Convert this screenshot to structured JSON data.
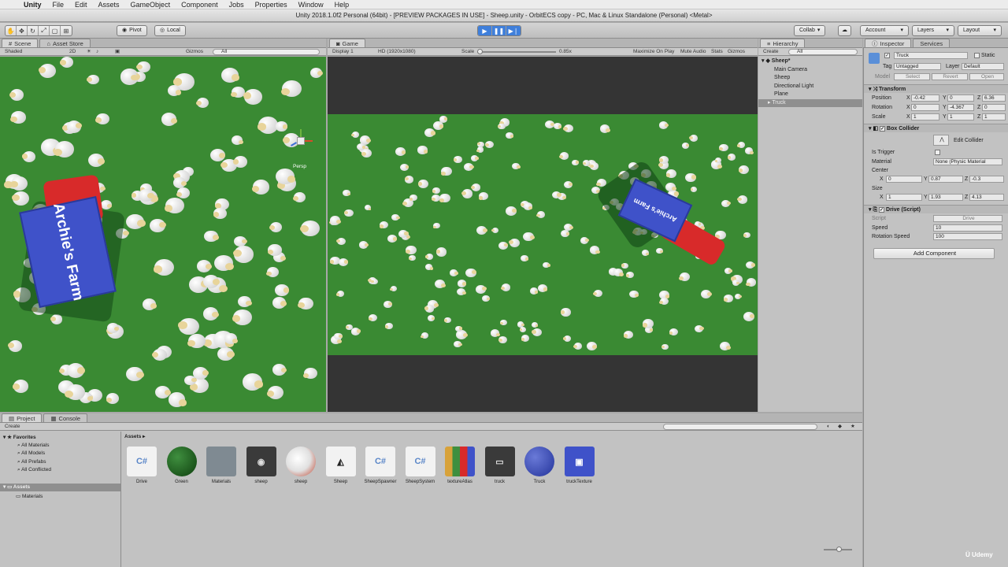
{
  "menubar": {
    "app": "Unity",
    "items": [
      "File",
      "Edit",
      "Assets",
      "GameObject",
      "Component",
      "Jobs",
      "Properties",
      "Window",
      "Help"
    ]
  },
  "window_title": "Unity 2018.1.0f2 Personal (64bit) - [PREVIEW PACKAGES IN USE] - Sheep.unity - OrbitECS copy - PC, Mac & Linux Standalone (Personal) <Metal>",
  "toolbar": {
    "pivot": "Pivot",
    "local": "Local",
    "collab": "Collab",
    "account": "Account",
    "layers": "Layers",
    "layout": "Layout"
  },
  "scene": {
    "tab": "Scene",
    "tab2": "Asset Store",
    "shading": "Shaded",
    "mode2d": "2D",
    "gizmos": "Gizmos",
    "search": "All",
    "persp": "Persp"
  },
  "game": {
    "tab": "Game",
    "display": "Display 1",
    "resolution": "HD (1920x1080)",
    "scale_label": "Scale",
    "scale_value": "0.85x",
    "max_on_play": "Maximize On Play",
    "mute": "Mute Audio",
    "stats": "Stats",
    "gizmos": "Gizmos"
  },
  "hierarchy": {
    "tab": "Hierarchy",
    "create": "Create",
    "search": "All",
    "scene": "Sheep*",
    "items": [
      "Main Camera",
      "Sheep",
      "Directional Light",
      "Plane",
      "Truck"
    ],
    "selected": "Truck"
  },
  "inspector": {
    "tab": "Inspector",
    "tab2": "Services",
    "name": "Truck",
    "static": "Static",
    "tag_label": "Tag",
    "tag": "Untagged",
    "layer_label": "Layer",
    "layer": "Default",
    "model_label": "Model",
    "model_buttons": [
      "Select",
      "Revert",
      "Open"
    ],
    "transform": {
      "title": "Transform",
      "position_label": "Position",
      "position": [
        "-0.42",
        "0",
        "6.36"
      ],
      "rotation_label": "Rotation",
      "rotation": [
        "0",
        "-4.367",
        "0"
      ],
      "scale_label": "Scale",
      "scale": [
        "1",
        "1",
        "1"
      ]
    },
    "box_collider": {
      "title": "Box Collider",
      "edit": "Edit Collider",
      "is_trigger": "Is Trigger",
      "material_label": "Material",
      "material": "None (Physic Material",
      "center_label": "Center",
      "center": [
        "0",
        "0.87",
        "-0.3"
      ],
      "size_label": "Size",
      "size": [
        "1",
        "1.93",
        "4.13"
      ]
    },
    "drive": {
      "title": "Drive (Script)",
      "script_label": "Script",
      "script": "Drive",
      "speed_label": "Speed",
      "speed": "10",
      "rot_label": "Rotation Speed",
      "rot": "100"
    },
    "add_component": "Add Component"
  },
  "project": {
    "tab": "Project",
    "tab2": "Console",
    "create": "Create",
    "favorites": "Favorites",
    "fav_items": [
      "All Materials",
      "All Models",
      "All Prefabs",
      "All Conflicted"
    ],
    "assets_root": "Assets",
    "assets_children": [
      "Materials"
    ],
    "breadcrumb": "Assets",
    "assets": [
      {
        "label": "Drive",
        "kind": "cs"
      },
      {
        "label": "Green",
        "kind": "material-green"
      },
      {
        "label": "Materials",
        "kind": "folder"
      },
      {
        "label": "sheep",
        "kind": "model"
      },
      {
        "label": "sheep",
        "kind": "sheep-tex"
      },
      {
        "label": "Sheep",
        "kind": "unity"
      },
      {
        "label": "SheepSpawner",
        "kind": "cs"
      },
      {
        "label": "SheepSystem",
        "kind": "cs"
      },
      {
        "label": "textureAtlas",
        "kind": "atlas"
      },
      {
        "label": "truck",
        "kind": "truck-model"
      },
      {
        "label": "Truck",
        "kind": "prefab"
      },
      {
        "label": "truckTexture",
        "kind": "truck-tex"
      }
    ]
  },
  "truck_text": "Archie's Farm",
  "brand": "Udemy"
}
